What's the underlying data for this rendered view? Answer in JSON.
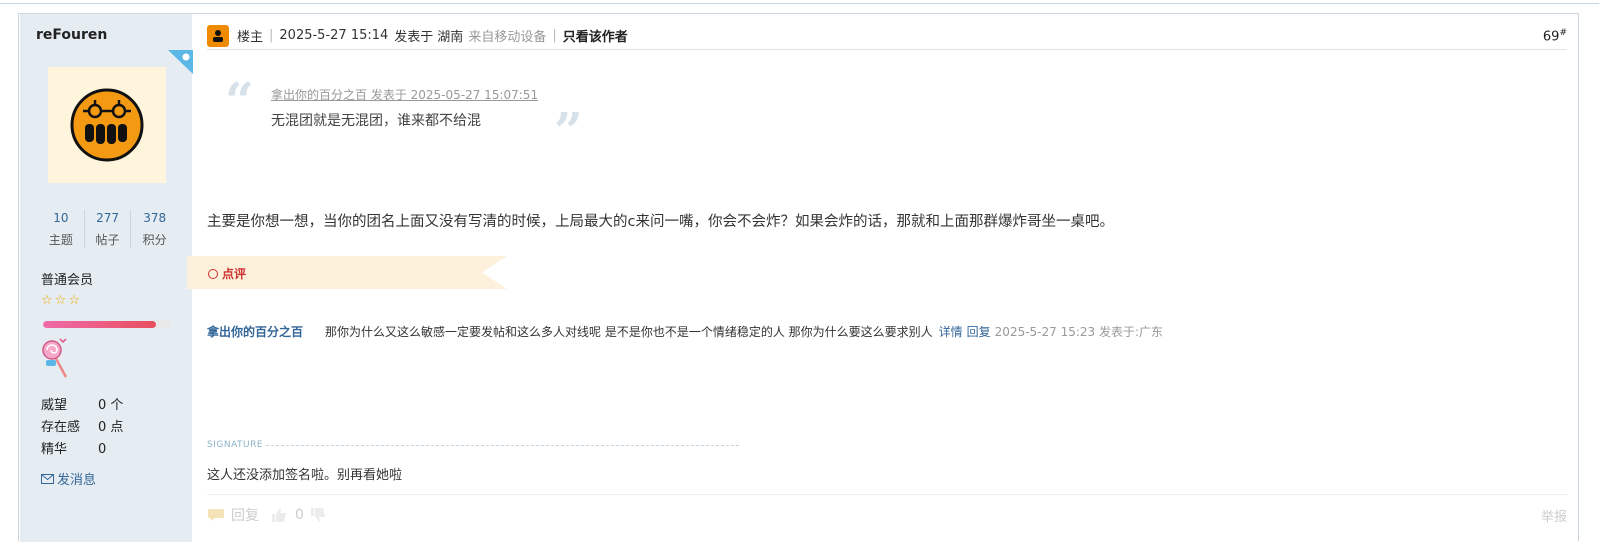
{
  "author": {
    "username": "reFouren",
    "stats": [
      {
        "value": "10",
        "label": "主题"
      },
      {
        "value": "277",
        "label": "帖子"
      },
      {
        "value": "378",
        "label": "积分"
      }
    ],
    "rank": "普通会员",
    "star_count": 3,
    "level_progress": 0.88,
    "info": [
      {
        "key": "威望",
        "value": "0 个"
      },
      {
        "key": "存在感",
        "value": "0 点"
      },
      {
        "key": "精华",
        "value": "0"
      }
    ],
    "send_message": "发消息"
  },
  "post": {
    "role": "楼主",
    "time": "2025-5-27 15:14",
    "location_prefix": "发表于",
    "location": "湖南",
    "device": "来自移动设备",
    "only_author": "只看该作者",
    "floor": "69",
    "floor_mark": "#",
    "quote_meta": "拿出你的百分之百 发表于 2025-05-27 15:07:51",
    "quote_body": "无混团就是无混团，谁来都不给混",
    "content": "主要是你想一想，当你的团名上面又没有写清的时候，上局最大的c来问一嘴，你会不会炸？如果会炸的话，那就和上面那群爆炸哥坐一桌吧。",
    "rate_label": "点评",
    "comment": {
      "user": "拿出你的百分之百",
      "text": "那你为什么又这么敏感一定要发帖和这么多人对线呢 是不是你也不是一个情绪稳定的人 那你为什么要这么要求别人",
      "detail": "详情",
      "reply": "回复",
      "time": "2025-5-27 15:23 发表于:广东"
    },
    "signature_label": "SIGNATURE",
    "signature": "这人还没添加签名啦。别再看她啦",
    "footer": {
      "reply": "回复",
      "likes": "0",
      "report": "举报"
    }
  },
  "colors": {
    "sidebar_bg": "#e5edf2",
    "link": "#336699",
    "accent_orange": "#f08a00",
    "rate_red": "#cc3333"
  }
}
